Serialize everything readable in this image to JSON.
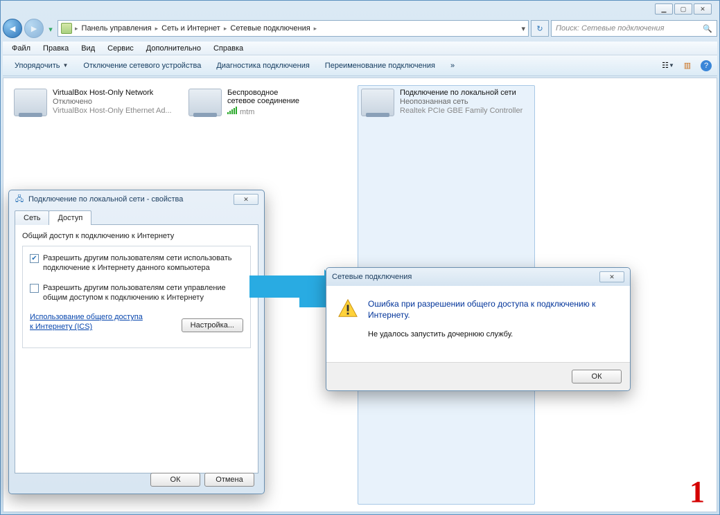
{
  "window_controls": {
    "minimize": "▁",
    "maximize": "▢",
    "close": "✕"
  },
  "breadcrumb": {
    "items": [
      "Панель управления",
      "Сеть и Интернет",
      "Сетевые подключения"
    ]
  },
  "search": {
    "placeholder": "Поиск: Сетевые подключения"
  },
  "menu": {
    "items": [
      "Файл",
      "Правка",
      "Вид",
      "Сервис",
      "Дополнительно",
      "Справка"
    ]
  },
  "toolbar": {
    "items": [
      "Упорядочить",
      "Отключение сетевого устройства",
      "Диагностика подключения",
      "Переименование подключения"
    ]
  },
  "connections": [
    {
      "name": "VirtualBox Host-Only Network",
      "status": "Отключено",
      "device": "VirtualBox Host-Only Ethernet Ad..."
    },
    {
      "name": "Беспроводное сетевое соединение",
      "status": "",
      "device": "mtm"
    },
    {
      "name": "Подключение по локальной сети",
      "status": "Неопознанная сеть",
      "device": "Realtek PCIe GBE Family Controller"
    }
  ],
  "props": {
    "title": "Подключение по локальной сети - свойства",
    "tabs": [
      "Сеть",
      "Доступ"
    ],
    "group_label": "Общий доступ к подключению к Интернету",
    "chk1": "Разрешить другим пользователям сети использовать подключение к Интернету данного компьютера",
    "chk2": "Разрешить другим пользователям сети управление общим доступом к подключению к Интернету",
    "link": "Использование общего доступа к Интернету (ICS)",
    "settings_btn": "Настройка...",
    "ok": "ОК",
    "cancel": "Отмена"
  },
  "error": {
    "title": "Сетевые подключения",
    "line1": "Ошибка при разрешении общего доступа к подключению к Интернету.",
    "line2": "Не удалось запустить дочернюю службу.",
    "ok": "ОК"
  },
  "annotation_number": "1"
}
